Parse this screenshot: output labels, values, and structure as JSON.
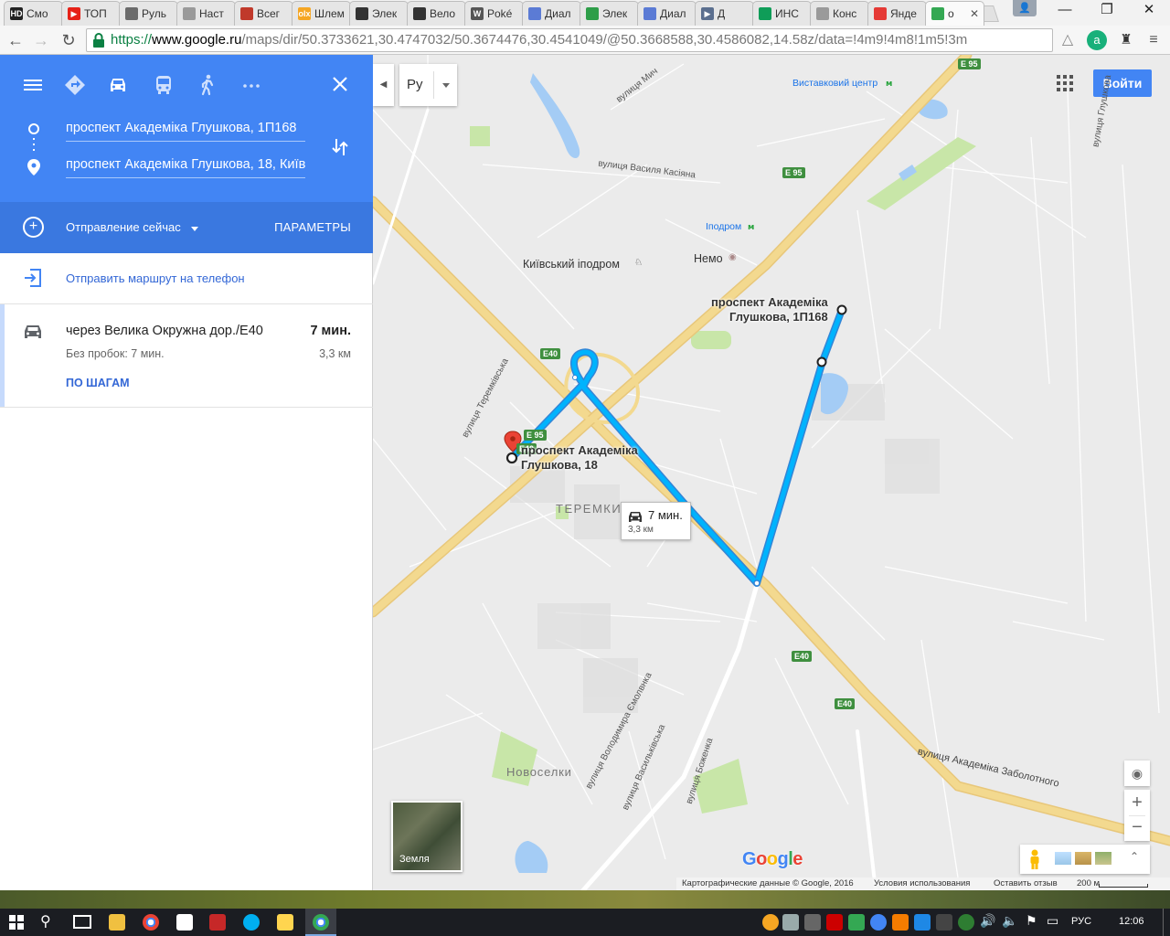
{
  "browser": {
    "tabs": [
      {
        "label": "Смо",
        "badge": "HD",
        "color": "#222222"
      },
      {
        "label": "ТОП",
        "badge": "▶",
        "color": "#e62117"
      },
      {
        "label": "Руль",
        "badge": "",
        "color": "#6b6b6b"
      },
      {
        "label": "Наст",
        "badge": "",
        "color": "#9a9a9a"
      },
      {
        "label": "Всег",
        "badge": "",
        "color": "#c0392b"
      },
      {
        "label": "Шлем",
        "badge": "olx",
        "color": "#f5a623"
      },
      {
        "label": "Элек",
        "badge": "",
        "color": "#333333"
      },
      {
        "label": "Вело",
        "badge": "",
        "color": "#333333"
      },
      {
        "label": "Poké",
        "badge": "W",
        "color": "#555555"
      },
      {
        "label": "Диал",
        "badge": "",
        "color": "#5b7bd5"
      },
      {
        "label": "Элек",
        "badge": "",
        "color": "#2e9e49"
      },
      {
        "label": "Диал",
        "badge": "",
        "color": "#5b7bd5"
      },
      {
        "label": "Д",
        "badge": "▶",
        "color": "#5b6f8f"
      },
      {
        "label": "ИНС",
        "badge": "",
        "color": "#0f9d58"
      },
      {
        "label": "Конс",
        "badge": "",
        "color": "#9a9a9a"
      },
      {
        "label": "Янде",
        "badge": "",
        "color": "#e53935"
      },
      {
        "label": "о",
        "badge": "",
        "color": "#34a853"
      }
    ],
    "url_scheme": "https://",
    "url_host": "www.google.ru",
    "url_path": "/maps/dir/50.3733621,30.4747032/50.3674476,30.4541049/@50.3668588,30.4586082,14.58z/data=!4m9!4m8!1m5!3m"
  },
  "directions": {
    "origin": "проспект Академіка Глушкова, 1П168",
    "destination": "проспект Академіка Глушкова, 18, Київ",
    "depart_label": "Отправление сейчас",
    "params_label": "ПАРАМЕТРЫ",
    "send_label": "Отправить маршрут на телефон",
    "route": {
      "via": "через Велика Окружна дор./E40",
      "time": "7 мин.",
      "traffic": "Без пробок: 7 мин.",
      "distance": "3,3 км",
      "steps_label": "ПО ШАГАМ"
    }
  },
  "map": {
    "search_text": "Ру",
    "signin_label": "Войти",
    "places": {
      "exhibition_centre": "Виставковий центр",
      "hippodrome_metro": "Іподром",
      "hippodrome": "Київський іподром",
      "nemo": "Немо",
      "teremky": "ТЕРЕМКИ",
      "novoselky": "Новоселки"
    },
    "streets": {
      "vasylya_kasiyana": "вулиця Василя Касіяна",
      "miche": "вулиця Мич",
      "teremkivska": "вулиця Теремківська",
      "smolenska": "вулиця Володимира Ємолвнка",
      "vasylkivska": "вулиця Васильківська",
      "bozhenka": "вулиця Боженка",
      "zabolotnoho": "вулиця Академіка Заболотного",
      "glushkova_label": "вулиця Глушкова"
    },
    "markers": {
      "origin_line1": "проспект Академіка",
      "origin_line2": "Глушкова, 1П168",
      "dest_line1": "проспект Академіка",
      "dest_line2": "Глушкова, 18"
    },
    "route_badge": {
      "time": "7 мин.",
      "distance": "3,3 км"
    },
    "shields": {
      "e95": "E 95",
      "e40": "E40"
    },
    "earth_label": "Земля",
    "footer": {
      "map_data": "Картографические данные © Google, 2016",
      "terms": "Условия использования",
      "feedback": "Оставить отзыв",
      "scale": "200 м"
    },
    "colors": {
      "route": "#00b3fd",
      "route_outline": "#3385d6",
      "highway": "#f3d98f"
    }
  },
  "taskbar": {
    "language": "РУС",
    "clock": "12:06"
  }
}
